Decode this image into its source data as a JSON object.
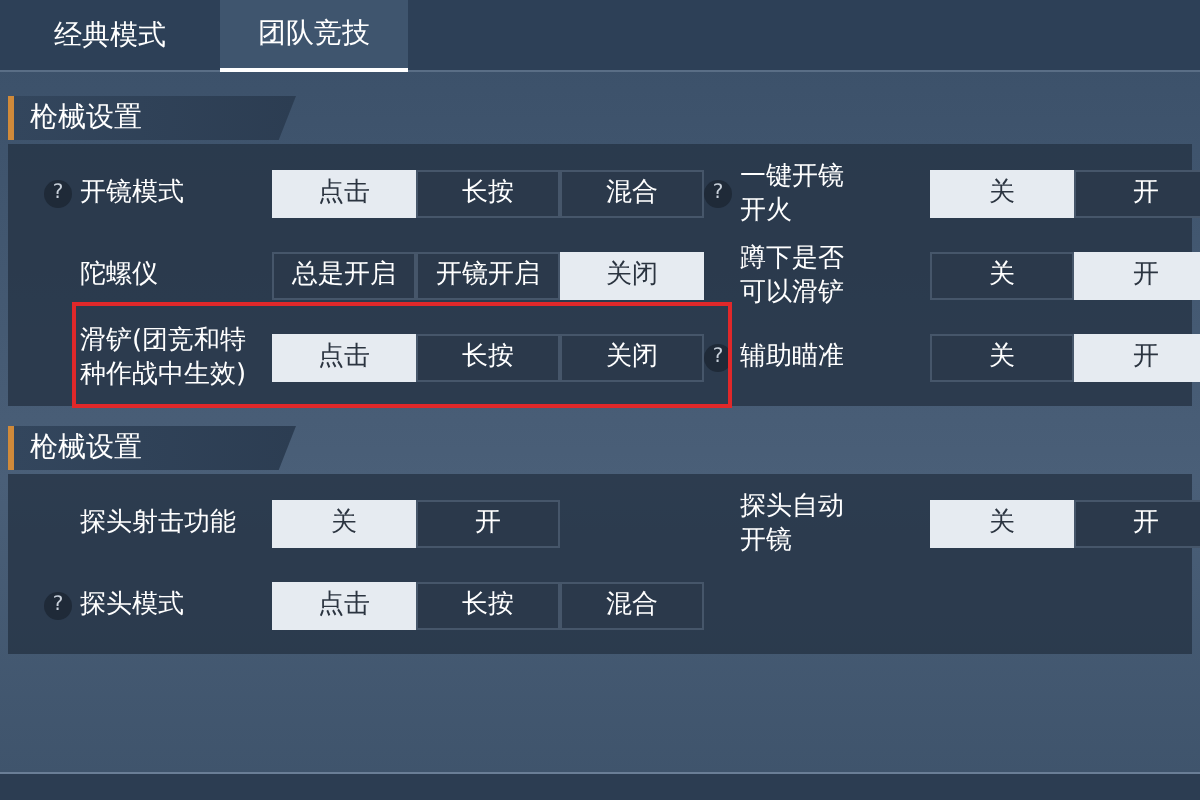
{
  "tabs": [
    {
      "label": "经典模式",
      "selected": false
    },
    {
      "label": "团队竞技",
      "selected": true
    }
  ],
  "sections": [
    {
      "title": "枪械设置",
      "rows": [
        {
          "highlighted": false,
          "settings": [
            {
              "help": "?",
              "label": "开镜模式",
              "options": [
                {
                  "label": "点击",
                  "selected": true
                },
                {
                  "label": "长按",
                  "selected": false
                },
                {
                  "label": "混合",
                  "selected": false
                }
              ]
            },
            {
              "help": "?",
              "label": "一键开镜开火",
              "options": [
                {
                  "label": "关",
                  "selected": true
                },
                {
                  "label": "开",
                  "selected": false
                }
              ]
            }
          ]
        },
        {
          "highlighted": false,
          "settings": [
            {
              "label": "陀螺仪",
              "options": [
                {
                  "label": "总是开启",
                  "selected": false
                },
                {
                  "label": "开镜开启",
                  "selected": false
                },
                {
                  "label": "关闭",
                  "selected": true
                }
              ]
            },
            {
              "label": "蹲下是否可以滑铲",
              "options": [
                {
                  "label": "关",
                  "selected": false
                },
                {
                  "label": "开",
                  "selected": true
                }
              ]
            }
          ]
        },
        {
          "highlighted": true,
          "settings": [
            {
              "label": "滑铲(团竞和特种作战中生效)",
              "options": [
                {
                  "label": "点击",
                  "selected": true
                },
                {
                  "label": "长按",
                  "selected": false
                },
                {
                  "label": "关闭",
                  "selected": false
                }
              ]
            },
            {
              "help": "?",
              "label": "辅助瞄准",
              "options": [
                {
                  "label": "关",
                  "selected": false
                },
                {
                  "label": "开",
                  "selected": true
                }
              ]
            }
          ]
        }
      ]
    },
    {
      "title": "枪械设置",
      "rows": [
        {
          "highlighted": false,
          "settings": [
            {
              "label": "探头射击功能",
              "options": [
                {
                  "label": "关",
                  "selected": true
                },
                {
                  "label": "开",
                  "selected": false
                }
              ]
            },
            {
              "label": "探头自动开镜",
              "options": [
                {
                  "label": "关",
                  "selected": true
                },
                {
                  "label": "开",
                  "selected": false
                }
              ]
            }
          ]
        },
        {
          "highlighted": false,
          "settings": [
            {
              "help": "?",
              "label": "探头模式",
              "options": [
                {
                  "label": "点击",
                  "selected": true
                },
                {
                  "label": "长按",
                  "selected": false
                },
                {
                  "label": "混合",
                  "selected": false
                }
              ]
            }
          ]
        }
      ]
    }
  ]
}
